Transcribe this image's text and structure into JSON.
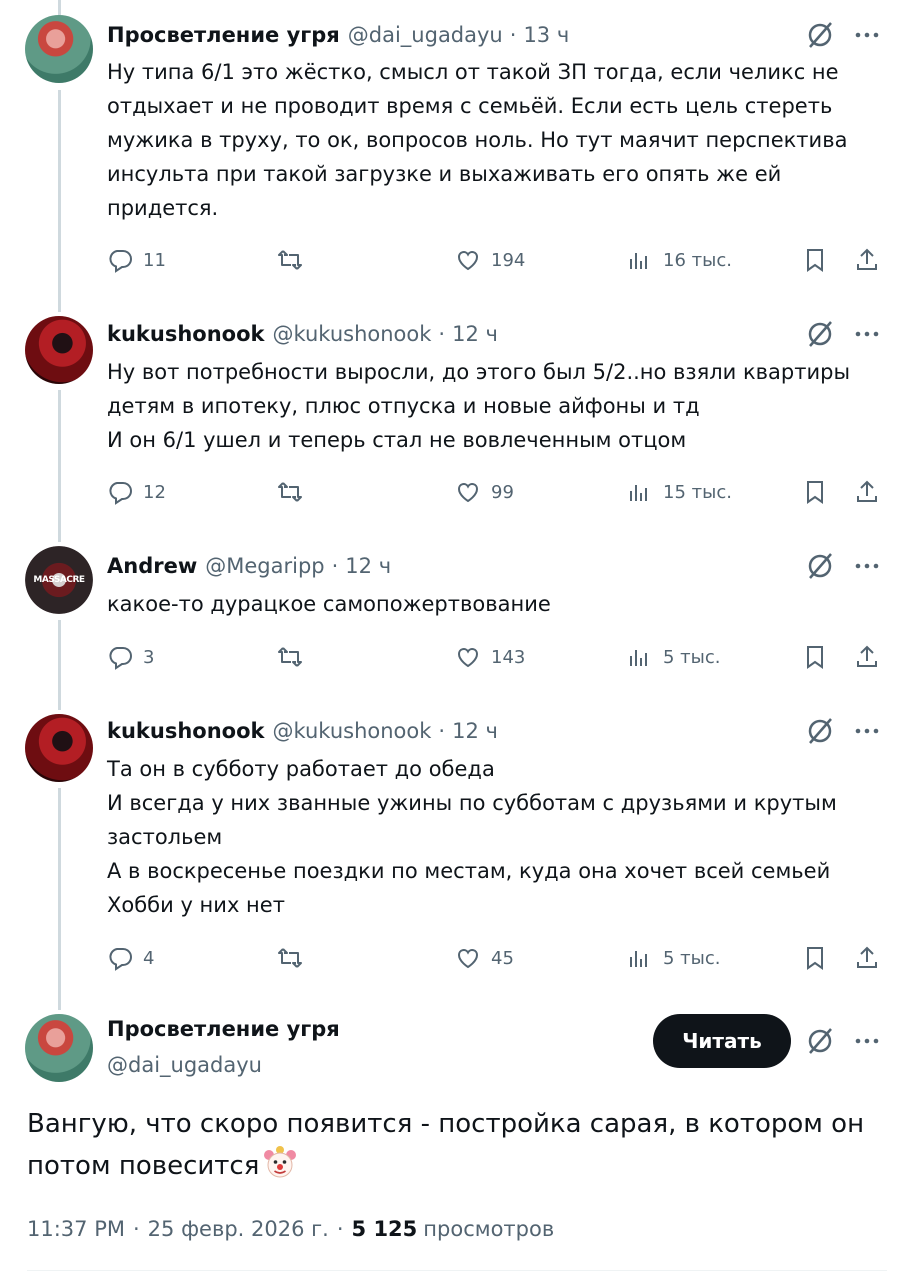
{
  "replies": [
    {
      "name": "Просветление угря",
      "handle": "@dai_ugadayu",
      "time": "13 ч",
      "avatar": "avatar-mermaid",
      "lines": [
        "Ну типа 6/1 это жёстко, смысл от такой ЗП тогда, если челикс не",
        "отдыхает и не проводит время с семьёй. Если есть цель стереть",
        "мужика в труху, то ок, вопросов ноль. Но тут маячит перспектива",
        "инсульта при такой загрузке и выхаживать его опять же ей",
        "придется."
      ],
      "replies": "11",
      "reposts": "",
      "likes": "194",
      "views": "16 тыс."
    },
    {
      "name": "kukushonook",
      "handle": "@kukushonook",
      "time": "12 ч",
      "avatar": "avatar-red-room",
      "lines": [
        "Ну вот потребности выросли, до этого был 5/2..но взяли квартиры",
        "детям в ипотеку, плюс отпуска и новые айфоны и тд",
        "И он 6/1 ушел и теперь стал не вовлеченным отцом"
      ],
      "replies": "12",
      "reposts": "",
      "likes": "99",
      "views": "15 тыс."
    },
    {
      "name": "Andrew",
      "handle": "@Megaripp",
      "time": "12 ч",
      "avatar": "avatar-massacre",
      "avatar_text": "MASSACRE",
      "lines": [
        "какое-то дурацкое самопожертвование"
      ],
      "replies": "3",
      "reposts": "",
      "likes": "143",
      "views": "5 тыс."
    },
    {
      "name": "kukushonook",
      "handle": "@kukushonook",
      "time": "12 ч",
      "avatar": "avatar-red-room",
      "lines": [
        "Та он в субботу работает до обеда",
        "И всегда у них званные ужины по субботам с друзьями и крутым",
        "застольем",
        "А в воскресенье поездки по местам, куда она хочет всей семьей",
        "Хобби у них нет"
      ],
      "replies": "4",
      "reposts": "",
      "likes": "45",
      "views": "5 тыс."
    }
  ],
  "main": {
    "name": "Просветление угря",
    "handle": "@dai_ugadayu",
    "follow_label": "Читать",
    "text_line1": "Вангую, что скоро появится - постройка сарая, в котором он",
    "text_line2": "потом повесится",
    "emoji": "clown-face",
    "time": "11:37 PM",
    "date": "25 февр. 2026 г.",
    "views_count": "5 125",
    "views_label": "просмотров"
  },
  "colors": {
    "text": "#0f1419",
    "secondary": "#536471",
    "thread_line": "#cfd9de"
  }
}
